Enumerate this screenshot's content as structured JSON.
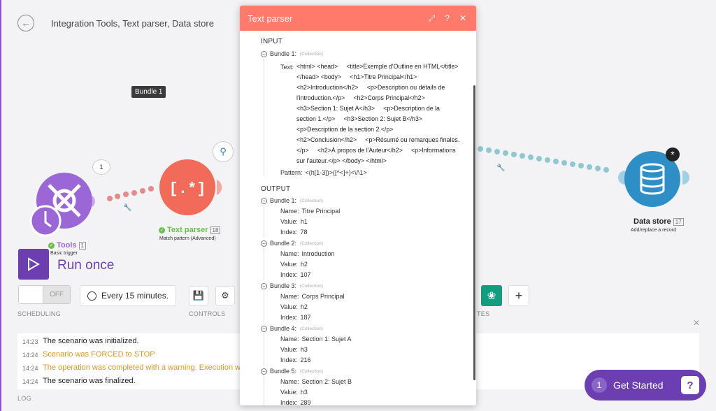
{
  "breadcrumb": "Integration Tools, Text parser, Data store",
  "bundle_tooltip": "Bundle 1",
  "nodes": {
    "tools": {
      "label": "Tools",
      "count": "1",
      "sub": "Basic trigger",
      "bubble": "1"
    },
    "parser": {
      "label": "Text parser",
      "count": "18",
      "sub": "Match pattern (Advanced)"
    },
    "store": {
      "label": "Data store",
      "count": "17",
      "sub": "Add/replace a record"
    }
  },
  "run": {
    "label": "Run once"
  },
  "scheduling": {
    "toggle": "OFF",
    "interval": "Every 15 minutes.",
    "caption": "SCHEDULING"
  },
  "controls": {
    "caption": "CONTROLS"
  },
  "tes_caption": "TES",
  "log": {
    "caption": "LOG",
    "rows": [
      {
        "time": "14:23",
        "msg": "The scenario was initialized.",
        "warn": false
      },
      {
        "time": "14:24",
        "msg": "Scenario was FORCED to STOP",
        "warn": true
      },
      {
        "time": "14:24",
        "msg": "The operation was completed with a warning. Execution w",
        "warn": true
      },
      {
        "time": "14:24",
        "msg": "The scenario was finalized.",
        "warn": false
      }
    ]
  },
  "get_started": {
    "num": "1",
    "label": "Get Started"
  },
  "panel": {
    "title": "Text parser",
    "input_label": "INPUT",
    "output_label": "OUTPUT",
    "collection": "(Collection)",
    "input_bundle": "Bundle 1:",
    "text_key": "Text:",
    "text_lines": [
      "<html> <head>     <title>Exemple d'Outline en HTML</title>",
      "</head> <body>     <h1>Titre Principal</h1>",
      "<h2>Introduction</h2>     <p>Description ou détails de",
      "l'introduction.</p>     <h2>Corps Principal</h2>",
      "<h3>Section 1: Sujet A</h3>     <p>Description de la",
      "section 1.</p>     <h3>Section 2: Sujet B</h3>",
      "<p>Description de la section 2.</p>",
      "<h2>Conclusion</h2>     <p>Résumé ou remarques finales.",
      "</p>     <h2>À propos de l'Auteur</h2>     <p>Informations",
      "sur l'auteur.</p> </body> </html>"
    ],
    "pattern_key": "Pattern:",
    "pattern_value": "<(h[1-3])>([^<]+)<\\/\\1>",
    "name_key": "Name:",
    "value_key": "Value:",
    "index_key": "Index:",
    "output_bundles": [
      {
        "label": "Bundle 1:",
        "name": "Titre Principal",
        "value": "h1",
        "index": "78"
      },
      {
        "label": "Bundle 2:",
        "name": "Introduction",
        "value": "h2",
        "index": "107"
      },
      {
        "label": "Bundle 3:",
        "name": "Corps Principal",
        "value": "h2",
        "index": "187"
      },
      {
        "label": "Bundle 4:",
        "name": "Section 1: Sujet A",
        "value": "h3",
        "index": "216"
      },
      {
        "label": "Bundle 5:",
        "name": "Section 2: Sujet B",
        "value": "h3",
        "index": "289"
      }
    ]
  }
}
